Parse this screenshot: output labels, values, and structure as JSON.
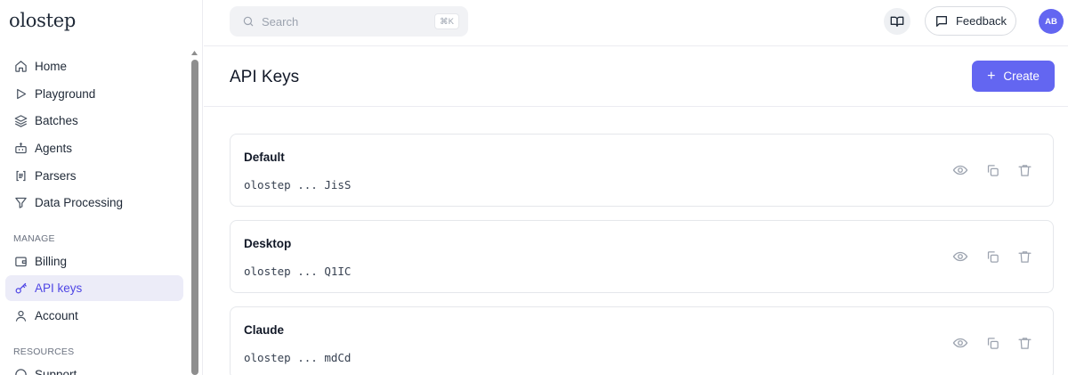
{
  "app": {
    "logo": "olostep"
  },
  "sidebar": {
    "items": [
      {
        "label": "Home",
        "icon": "home-icon"
      },
      {
        "label": "Playground",
        "icon": "play-icon"
      },
      {
        "label": "Batches",
        "icon": "layers-icon"
      },
      {
        "label": "Agents",
        "icon": "bot-icon"
      },
      {
        "label": "Parsers",
        "icon": "parser-icon"
      },
      {
        "label": "Data Processing",
        "icon": "filter-icon"
      }
    ],
    "manage_label": "MANAGE",
    "manage_items": [
      {
        "label": "Billing",
        "icon": "wallet-icon"
      },
      {
        "label": "API keys",
        "icon": "key-icon",
        "active": true
      },
      {
        "label": "Account",
        "icon": "user-icon"
      }
    ],
    "resources_label": "RESOURCES",
    "resources_items": [
      {
        "label": "Support",
        "icon": "support-icon"
      }
    ]
  },
  "topbar": {
    "search_placeholder": "Search",
    "search_shortcut": "⌘K",
    "feedback_label": "Feedback",
    "avatar_initials": "AB"
  },
  "page": {
    "title": "API Keys",
    "create_label": "Create"
  },
  "keys": [
    {
      "name": "Default",
      "prefix": "olostep",
      "ellipsis": "...",
      "suffix": "JisS"
    },
    {
      "name": "Desktop",
      "prefix": "olostep",
      "ellipsis": "...",
      "suffix": "Q1IC"
    },
    {
      "name": "Claude",
      "prefix": "olostep",
      "ellipsis": "...",
      "suffix": "mdCd"
    }
  ],
  "colors": {
    "accent": "#6366f1",
    "active_bg": "#ececf8",
    "active_text": "#4f46e5",
    "icon_muted": "#9ca3af"
  }
}
